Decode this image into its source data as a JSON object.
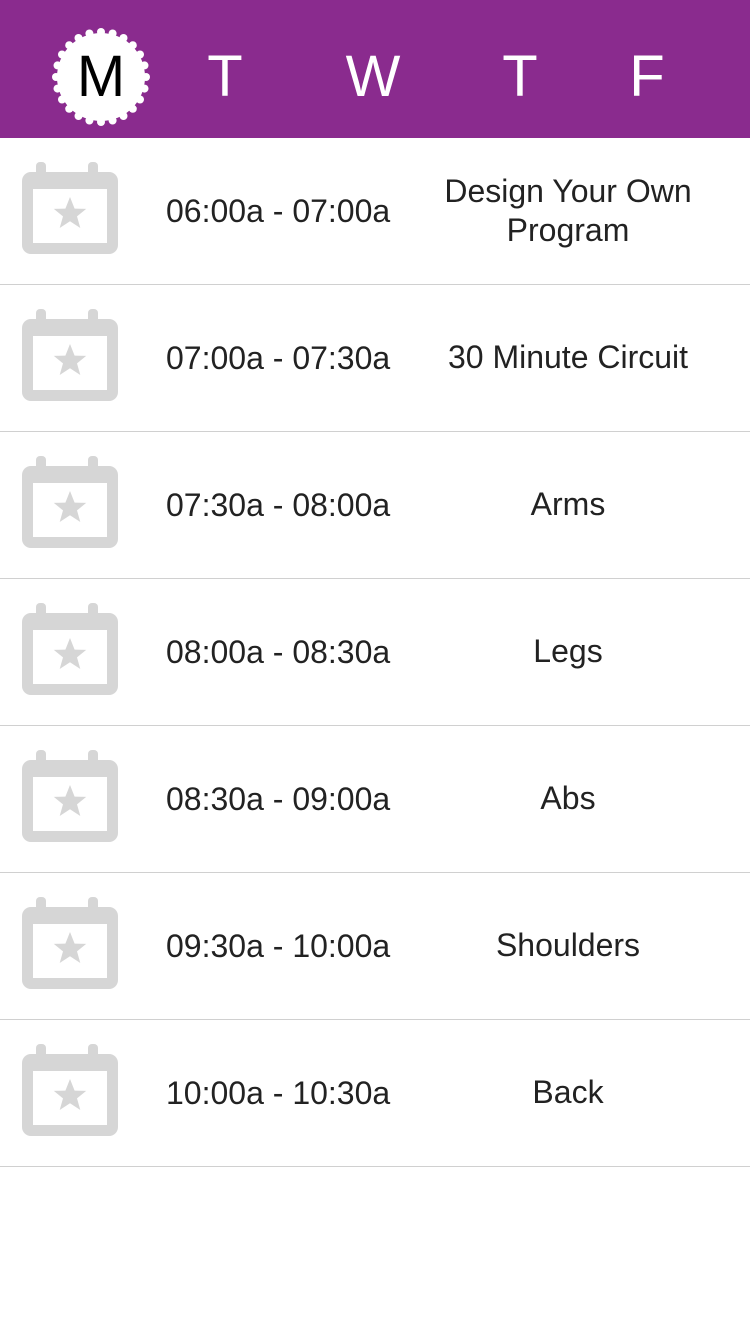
{
  "colors": {
    "header_bg": "#8a2b8e",
    "selected_badge": "#ffffff",
    "icon_gray": "#d6d6d6",
    "divider": "#d0d0d0",
    "text": "#222222"
  },
  "days": [
    {
      "letter": "M",
      "selected": true
    },
    {
      "letter": "T",
      "selected": false
    },
    {
      "letter": "W",
      "selected": false
    },
    {
      "letter": "T",
      "selected": false
    },
    {
      "letter": "F",
      "selected": false
    }
  ],
  "schedule": [
    {
      "icon": "calendar-star-icon",
      "time": "06:00a - 07:00a",
      "program": "Design Your Own Program"
    },
    {
      "icon": "calendar-star-icon",
      "time": "07:00a - 07:30a",
      "program": "30 Minute Circuit"
    },
    {
      "icon": "calendar-star-icon",
      "time": "07:30a - 08:00a",
      "program": "Arms"
    },
    {
      "icon": "calendar-star-icon",
      "time": "08:00a - 08:30a",
      "program": "Legs"
    },
    {
      "icon": "calendar-star-icon",
      "time": "08:30a - 09:00a",
      "program": "Abs"
    },
    {
      "icon": "calendar-star-icon",
      "time": "09:30a - 10:00a",
      "program": "Shoulders"
    },
    {
      "icon": "calendar-star-icon",
      "time": "10:00a - 10:30a",
      "program": "Back"
    }
  ]
}
